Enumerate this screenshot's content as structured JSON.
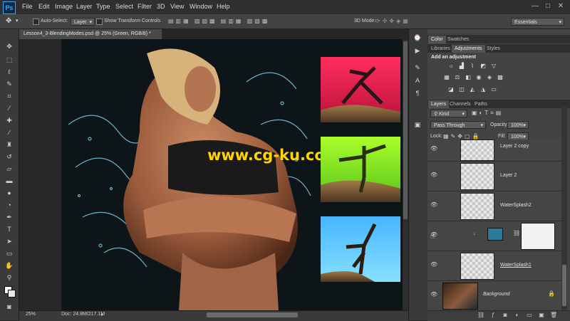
{
  "app": {
    "logo": "Ps"
  },
  "menu": [
    "File",
    "Edit",
    "Image",
    "Layer",
    "Type",
    "Select",
    "Filter",
    "3D",
    "View",
    "Window",
    "Help"
  ],
  "window_controls": {
    "minimize": "—",
    "maximize": "□",
    "close": "✕"
  },
  "options_bar": {
    "auto_select_label": "Auto-Select:",
    "auto_select_value": "Layer",
    "show_transform_label": "Show Transform Controls",
    "mode_3d_label": "3D Mode:",
    "workspace": "Essentials"
  },
  "document": {
    "tab_title": "Lesson4_3-BlendingModes.psd @ 25% (Green, RGB/8) *",
    "watermark": "www.cg-ku.com"
  },
  "status": {
    "zoom": "25%",
    "doc_info": "Doc: 24.8M/217.1M"
  },
  "panels": {
    "color_tabs": [
      "Color",
      "Swatches"
    ],
    "adjust_tabs": [
      "Libraries",
      "Adjustments",
      "Styles"
    ],
    "add_adjustment_label": "Add an adjustment",
    "layers_tabs": [
      "Layers",
      "Channels",
      "Paths"
    ],
    "filter_kind": "Kind",
    "blend_mode": "Pass Through",
    "opacity_label": "Opacity:",
    "opacity_value": "100%",
    "lock_label": "Lock:",
    "fill_label": "Fill:",
    "fill_value": "100%"
  },
  "layers": [
    {
      "name": "Layer 2 copy"
    },
    {
      "name": "Layer 2"
    },
    {
      "name": "WaterSplash2"
    },
    {
      "name": ""
    },
    {
      "name": "WaterSplash1"
    },
    {
      "name": "Background"
    }
  ],
  "colors": {
    "accent": "#3fa9f5",
    "panel": "#434343",
    "canvas": "#0d1519"
  }
}
